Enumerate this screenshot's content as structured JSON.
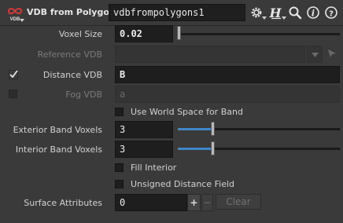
{
  "header": {
    "node_type": "VDB from Polygons",
    "node_name": "vdbfrompolygons1"
  },
  "params": {
    "voxel_size": {
      "label": "Voxel Size",
      "value": "0.02"
    },
    "reference_vdb": {
      "label": "Reference VDB",
      "value": ""
    },
    "distance_vdb": {
      "label": "Distance VDB",
      "value": "B",
      "enabled": true
    },
    "fog_vdb": {
      "label": "Fog VDB",
      "value": "a",
      "enabled": false
    },
    "use_world_space": {
      "label": "Use World Space for Band",
      "checked": false
    },
    "exterior_band": {
      "label": "Exterior Band Voxels",
      "value": "3"
    },
    "interior_band": {
      "label": "Interior Band Voxels",
      "value": "3"
    },
    "fill_interior": {
      "label": "Fill Interior",
      "checked": false
    },
    "unsigned_distance": {
      "label": "Unsigned Distance Field",
      "checked": false
    },
    "surface_attributes": {
      "label": "Surface Attributes",
      "value": "0",
      "add_label": "+",
      "remove_label": "−",
      "clear_label": "Clear"
    }
  },
  "colors": {
    "accent": "#3f86c8",
    "brand_red": "#d23a3a",
    "field_bg": "#1e1e1e",
    "panel_bg": "#3a3a3a"
  }
}
